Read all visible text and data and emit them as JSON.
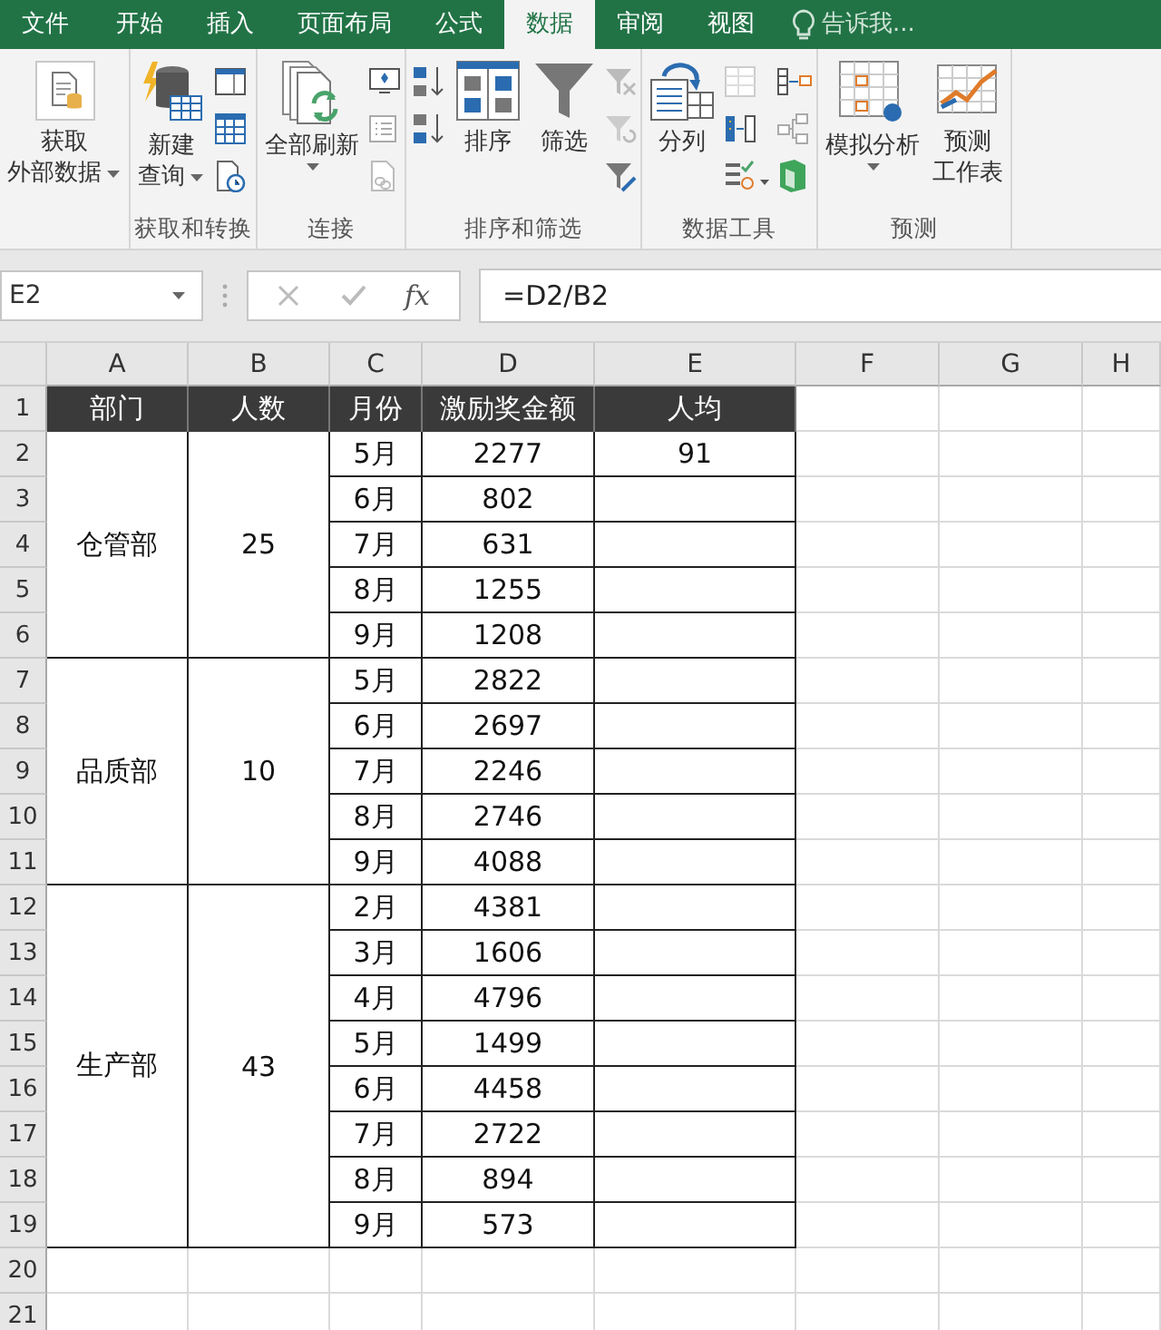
{
  "ribbon_tabs": [
    {
      "label": "文件",
      "selected": false
    },
    {
      "label": "开始",
      "selected": false
    },
    {
      "label": "插入",
      "selected": false
    },
    {
      "label": "页面布局",
      "selected": false
    },
    {
      "label": "公式",
      "selected": false
    },
    {
      "label": "数据",
      "selected": true
    },
    {
      "label": "审阅",
      "selected": false
    },
    {
      "label": "视图",
      "selected": false
    }
  ],
  "tell_me": {
    "placeholder": "告诉我..."
  },
  "ribbon_groups": [
    {
      "buttons": [
        {
          "lines": [
            "获取",
            "外部数据"
          ],
          "dropdown": true
        }
      ]
    },
    {
      "label": "获取和转换",
      "buttons": [
        {
          "lines": [
            "新建",
            "查询"
          ],
          "dropdown": true
        }
      ]
    },
    {
      "label": "连接",
      "buttons": [
        {
          "lines": [
            "全部刷新"
          ],
          "dropdown": true
        }
      ]
    },
    {
      "label": "排序和筛选",
      "buttons": [
        {
          "lines": [
            "排序"
          ]
        },
        {
          "lines": [
            "筛选"
          ]
        }
      ]
    },
    {
      "label": "数据工具",
      "buttons": [
        {
          "lines": [
            "分列"
          ]
        }
      ]
    },
    {
      "label": "预测",
      "buttons": [
        {
          "lines": [
            "模拟分析"
          ],
          "dropdown": true
        },
        {
          "lines": [
            "预测",
            "工作表"
          ]
        }
      ]
    }
  ],
  "formula_bar": {
    "name_box": "E2",
    "function_symbol": "fx",
    "formula": "=D2/B2"
  },
  "sheet": {
    "columns": [
      "A",
      "B",
      "C",
      "D",
      "E",
      "F",
      "G",
      "H"
    ],
    "row_numbers": [
      "1",
      "2",
      "3",
      "4",
      "5",
      "6",
      "7",
      "8",
      "9",
      "10",
      "11",
      "12",
      "13",
      "14",
      "15",
      "16",
      "17",
      "18",
      "19",
      "20",
      "21"
    ],
    "header": [
      "部门",
      "人数",
      "月份",
      "激励奖金额",
      "人均"
    ],
    "departments": [
      {
        "name": "仓管部",
        "headcount": "25",
        "months": [
          {
            "month": "5月",
            "amount": "2277",
            "per_capita": "91"
          },
          {
            "month": "6月",
            "amount": "802"
          },
          {
            "month": "7月",
            "amount": "631"
          },
          {
            "month": "8月",
            "amount": "1255"
          },
          {
            "month": "9月",
            "amount": "1208"
          }
        ]
      },
      {
        "name": "品质部",
        "headcount": "10",
        "months": [
          {
            "month": "5月",
            "amount": "2822"
          },
          {
            "month": "6月",
            "amount": "2697"
          },
          {
            "month": "7月",
            "amount": "2246"
          },
          {
            "month": "8月",
            "amount": "2746"
          },
          {
            "month": "9月",
            "amount": "4088"
          }
        ]
      },
      {
        "name": "生产部",
        "headcount": "43",
        "months": [
          {
            "month": "2月",
            "amount": "4381"
          },
          {
            "month": "3月",
            "amount": "1606"
          },
          {
            "month": "4月",
            "amount": "4796"
          },
          {
            "month": "5月",
            "amount": "1499"
          },
          {
            "month": "6月",
            "amount": "4458"
          },
          {
            "month": "7月",
            "amount": "2722"
          },
          {
            "month": "8月",
            "amount": "894"
          },
          {
            "month": "9月",
            "amount": "573"
          }
        ]
      }
    ]
  }
}
